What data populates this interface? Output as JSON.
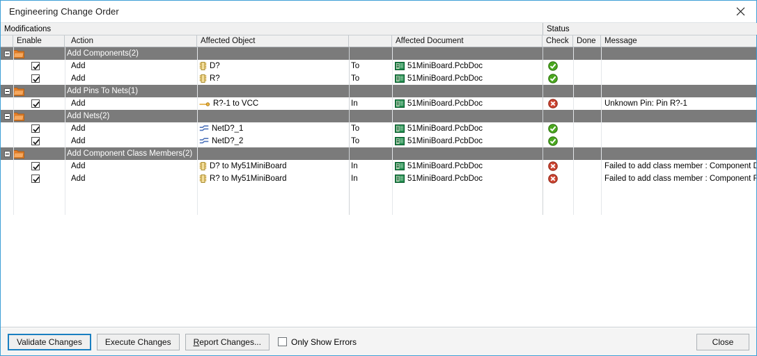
{
  "window": {
    "title": "Engineering Change Order",
    "close_icon": "close-icon"
  },
  "panel": {
    "modifications_label": "Modifications",
    "status_group_label": "Status"
  },
  "columns": {
    "expand": "",
    "enable": "Enable",
    "action": "Action",
    "affected_object": "Affected Object",
    "to": "",
    "affected_document": "Affected Document",
    "check": "Check",
    "done": "Done",
    "message": "Message"
  },
  "groups": [
    {
      "label": "Add Components(2)",
      "icon": "folder-icon",
      "expanded": true,
      "rows": [
        {
          "enabled": true,
          "action": "Add",
          "object": "D?",
          "object_icon": "component-icon",
          "to": "To",
          "document": "51MiniBoard.PcbDoc",
          "document_icon": "pcb-document-icon",
          "check": "ok",
          "done": "",
          "message": ""
        },
        {
          "enabled": true,
          "action": "Add",
          "object": "R?",
          "object_icon": "component-icon",
          "to": "To",
          "document": "51MiniBoard.PcbDoc",
          "document_icon": "pcb-document-icon",
          "check": "ok",
          "done": "",
          "message": ""
        }
      ]
    },
    {
      "label": "Add Pins To Nets(1)",
      "icon": "folder-icon",
      "expanded": true,
      "rows": [
        {
          "enabled": true,
          "action": "Add",
          "object": "R?-1 to VCC",
          "object_icon": "pin-icon",
          "to": "In",
          "document": "51MiniBoard.PcbDoc",
          "document_icon": "pcb-document-icon",
          "check": "error",
          "done": "",
          "message": "Unknown Pin: Pin R?-1"
        }
      ]
    },
    {
      "label": "Add Nets(2)",
      "icon": "folder-icon",
      "expanded": true,
      "rows": [
        {
          "enabled": true,
          "action": "Add",
          "object": "NetD?_1",
          "object_icon": "net-icon",
          "to": "To",
          "document": "51MiniBoard.PcbDoc",
          "document_icon": "pcb-document-icon",
          "check": "ok",
          "done": "",
          "message": ""
        },
        {
          "enabled": true,
          "action": "Add",
          "object": "NetD?_2",
          "object_icon": "net-icon",
          "to": "To",
          "document": "51MiniBoard.PcbDoc",
          "document_icon": "pcb-document-icon",
          "check": "ok",
          "done": "",
          "message": ""
        }
      ]
    },
    {
      "label": "Add Component Class Members(2)",
      "icon": "folder-icon",
      "expanded": true,
      "rows": [
        {
          "enabled": true,
          "action": "Add",
          "object": "D? to My51MiniBoard",
          "object_icon": "component-icon",
          "to": "In",
          "document": "51MiniBoard.PcbDoc",
          "document_icon": "pcb-document-icon",
          "check": "error",
          "done": "",
          "message": "Failed to add class member : Component D"
        },
        {
          "enabled": true,
          "action": "Add",
          "object": "R? to My51MiniBoard",
          "object_icon": "component-icon",
          "to": "In",
          "document": "51MiniBoard.PcbDoc",
          "document_icon": "pcb-document-icon",
          "check": "error",
          "done": "",
          "message": "Failed to add class member : Component R"
        }
      ]
    }
  ],
  "footer": {
    "validate_label": "Validate Changes",
    "execute_label": "Execute Changes",
    "report_label_pre": "R",
    "report_label_post": "eport Changes...",
    "only_show_errors_label": "Only Show Errors",
    "only_show_errors_checked": false,
    "close_label": "Close"
  },
  "colors": {
    "accent": "#3e9fd6",
    "group_row": "#7b7b7b",
    "ok": "#3a9f29",
    "error": "#c0392b",
    "folder": "#e8802a"
  }
}
